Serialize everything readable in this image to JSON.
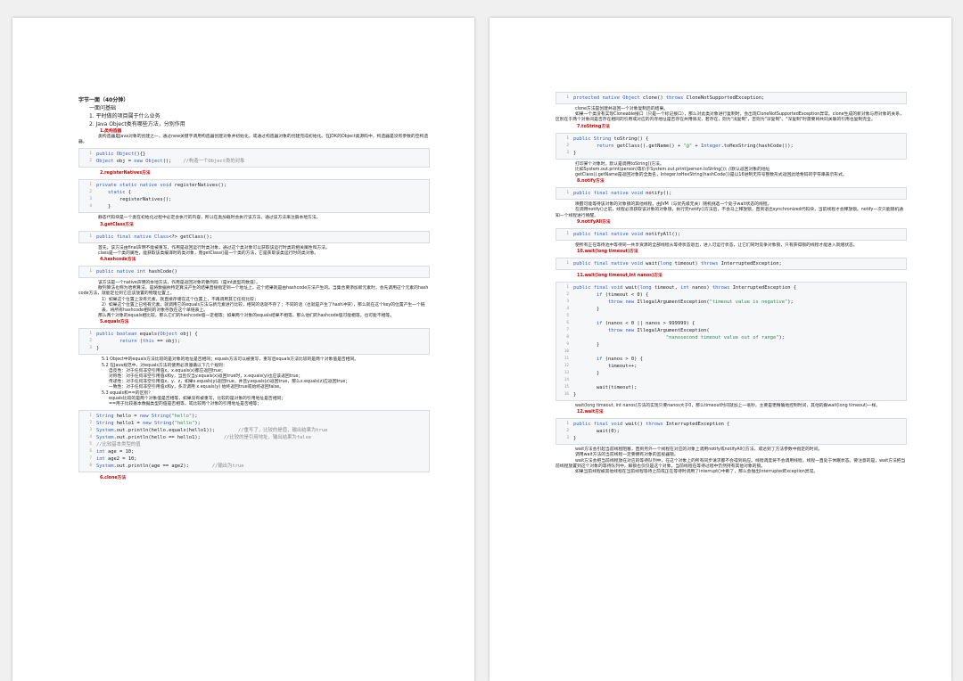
{
  "page1": {
    "heading": "字节一面（40分钟）",
    "sections": [
      {
        "type": "h2",
        "text": "一面问基础"
      },
      {
        "type": "h2",
        "text": "1. 平时做的项目属于什么业务"
      },
      {
        "type": "h2",
        "text": "2. Java Object类有哪些方法，分别作用"
      },
      {
        "type": "h3",
        "text": "1.类构造器"
      },
      {
        "type": "p",
        "text": "类构造器是Java对象的创建之一，通过new关键字调用构造器创建对象并初始化，或通过构造器对象的创建完成初始化。在JDK的Object类源码中，构造器是没有参数的空构造器。"
      },
      {
        "type": "code",
        "lines": [
          "public Object(){}",
          "Object obj = new Object();    //构造一个Object类的对象"
        ]
      },
      {
        "type": "h3",
        "text": "2.registerNatives方法"
      },
      {
        "type": "code",
        "lines": [
          "private static native void registerNatives();",
          "    static {",
          "        registerNatives();",
          "    }"
        ]
      },
      {
        "type": "p",
        "text": "静态代码块是一个类在初始化过程中必定会执行的内容，所以在类加载时会执行该方法，通过该方法来注册本地方法。"
      },
      {
        "type": "h3",
        "text": "3.getClass方法"
      },
      {
        "type": "code",
        "lines": [
          "public final native Class<?> getClass();"
        ]
      },
      {
        "type": "p",
        "text": "首先，该方法由final声明不能被重写，作用是返回运行时类对象，通过这个类对象可以获取该运行时类的相关属性和方法。"
      },
      {
        "type": "p",
        "text": "class是一个类的属性，能获取该类编译时的类对象，而getClass()是一个类的方法，它是获取该类运行时的类对象。"
      },
      {
        "type": "h3",
        "text": "4.hashcode方法"
      },
      {
        "type": "code",
        "lines": [
          "public native int hashCode()"
        ]
      },
      {
        "type": "p",
        "text": "该方法是一个native声明的本地方法，作用是返回对象的散列码（是int类型的数值）。"
      },
      {
        "type": "p",
        "text": "散列算法也称为哈希算法，是将数据依特定算法产生的结果直接指定到一个地址上，这个结果就是由hashcode方法产生的。当集合要添加新元素时，会先调用这个元素的hashcode方法，就能定位到它应该放置的物理位置上。"
      },
      {
        "type": "p2",
        "text": "1）如果这个位置上没有元素，就直接存储在这个位置上，不再调用其它任何比较；"
      },
      {
        "type": "p2",
        "text": "2）如果这个位置上已经有元素，就调用它的equals方法与新元素进行比较，相同的话就不存了；不同的话（也就是产生了hash冲突），那么就在这个key的位置产生一个链表，将所有hashcode相同的对象存放在这个单链表上。"
      },
      {
        "type": "p",
        "text": "那么两个对象的equals相比较，那么它们的hashcode值一定相等；如果两个对象的equals结果不相等，那么他们的hashcode值可能相等，也可能不相等。"
      },
      {
        "type": "h3",
        "text": "5.equals方法"
      },
      {
        "type": "code",
        "lines": [
          "public boolean equals(Object obj) {",
          "        return (this == obj);",
          "}"
        ]
      },
      {
        "type": "p2",
        "text": "5.1 Object中的equals方法比较的是对象的地址是否相同；equals方法可以被重写，重写后equals方法比较的是两个对象值是否相同。"
      },
      {
        "type": "p2",
        "text": "5.2 在Java规范中，对equals方法的使用必须遵循以下几个规则："
      },
      {
        "type": "p3",
        "text": "自反性：对于任何非空引用值x，x.equals(x)都应返回true；"
      },
      {
        "type": "p3",
        "text": "对称性：对于任何非空引用值x和y，当且仅当y.equals(x)返回true时，x.equals(y)也应该返回true；"
      },
      {
        "type": "p3",
        "text": "传递性：对于任何非空引用值x、y、z，如果x.equals(y)返回true，并且y.equals(z)返回true，那么x.equals(z)应返回true；"
      },
      {
        "type": "p3",
        "text": "一致性：对于任何非空引用值x和y，多次调用 x.equals(y) 始终返回true或始终返回false。"
      },
      {
        "type": "p2",
        "text": "5.3 equals和==的区别？"
      },
      {
        "type": "p3",
        "text": "equals比较的是两个对象值是否相等，如果没有被重写，比较的是对象的引用地址是否相同；"
      },
      {
        "type": "p3",
        "text": "==用于比较基本数据类型的值是否相等，或比较两个对象的引用地址是否相等；"
      },
      {
        "type": "code",
        "lines": [
          "String hello = new String(\"hello\");",
          "String hello1 = new String(\"hello\");",
          "System.out.println(hello.equals(hello1));        //重写了，比较的是值，输出结果为true",
          "System.out.println(hello == hello1);        //比较的是引用地址，输出结果为false",
          "//比较基本类型的值",
          "int age = 10;",
          "int age2 = 10;",
          "System.out.println(age == age2);        //输出为true"
        ]
      },
      {
        "type": "h3",
        "text": "6.clone方法"
      }
    ]
  },
  "page2": {
    "sections": [
      {
        "type": "code",
        "lines": [
          "protected native Object clone() throws CloneNotSupportedException;"
        ]
      },
      {
        "type": "p",
        "text": "clone方法是创建并返回一个对象复制后的结果。"
      },
      {
        "type": "p",
        "text": "如果一个类没有实现Cloneable接口（只是一个标记接口），那么对此类对象进行复制时，会出现CloneNotSupportedException异常。clone生成的新对象与原对象的关系，区别在于两个对象间是否存在相同的引用或对应的内存地址是否存在共用情况，若存在，则为\"浅复制\"，否则为\"深复制\"。\"深复制\"时需要将共同关联的引用也复制完全。"
      },
      {
        "type": "h3",
        "text": "7.toString方法"
      },
      {
        "type": "code",
        "lines": [
          "public String toString() {",
          "        return getClass().getName() + \"@\" + Integer.toHexString(hashCode());",
          "}"
        ]
      },
      {
        "type": "p",
        "text": "打印某个对象时，默认是调用toString()方法。"
      },
      {
        "type": "p",
        "text": "比如System.out.print(person)等价于System.out.print(person.toString());  //默认返回对象的地址"
      },
      {
        "type": "p",
        "text": "getClass().getName是返回对象的全类名，Integer.toHexString(hashCode())是以16进制无符号整数形式返回此哈希码的字符串表示形式。"
      },
      {
        "type": "h3",
        "text": "8.notify方法"
      },
      {
        "type": "code",
        "lines": [
          "public final native void notify();"
        ]
      },
      {
        "type": "p",
        "text": "唤醒可能等待该对象的对象锁的其他线程。由JVM（与优先级无关）随机挑选一个处于wait状态的线程。"
      },
      {
        "type": "p",
        "text": "在调用notify()之前，线程必须获取该对象的对象锁，执行完notify()方法后，不会马上释放锁，直到退出synchronized代码块，当前线程才会释放锁。notify一次只能随机通知一个线程进行唤醒。"
      },
      {
        "type": "h3",
        "text": "9.notifyAll方法"
      },
      {
        "type": "code",
        "lines": [
          "public final native void notifyAll();"
        ]
      },
      {
        "type": "p",
        "text": "使所有正在等待池中等待同一共享资源的全部线程从等待状态退出，进入可运行状态，让它们同时竞争对象锁，只有获得锁的线程才能进入就绪状态。"
      },
      {
        "type": "h3",
        "text": "10.wait(long timeout)方法"
      },
      {
        "type": "code",
        "lines": [
          "public final native void wait(long timeout) throws InterruptedException;"
        ]
      },
      {
        "type": "h3",
        "text": "11.wait(long timeout,int nanos)方法"
      },
      {
        "type": "code",
        "lines": [
          "public final void wait(long timeout, int nanos) throws InterruptedException {",
          "        if (timeout < 0) {",
          "            throw new IllegalArgumentException(\"timeout value is negative\");",
          "        }",
          "",
          "        if (nanos < 0 || nanos > 999999) {",
          "            throw new IllegalArgumentException(",
          "                                \"nanosecond timeout value out of range\");",
          "        }",
          "",
          "        if (nanos > 0) {",
          "            timeout++;",
          "        }",
          "",
          "        wait(timeout);",
          "}"
        ]
      },
      {
        "type": "p",
        "text": "wait(long timeout, int nanos)方法的实现只要nanos大于0，那么timeout时间就加上一毫秒，主要是更精确地控制时间，其他的跟wait(long timeout)一样。"
      },
      {
        "type": "h3",
        "text": "12.wait方法"
      },
      {
        "type": "code",
        "lines": [
          "public final void wait() throws InterruptedException {",
          "        wait(0);",
          "}"
        ]
      },
      {
        "type": "p",
        "text": "wait方法会引起当前线程阻塞，直到另外一个线程在对应的对象上调用notify或notifyAll()方法，或达到了方法参数中指定的时间。"
      },
      {
        "type": "p",
        "text": "调用wait方法的当前线程一定要拥有对象的监视器锁。"
      },
      {
        "type": "p",
        "text": "wait方法会把当前线程放在对应的等待队列中，在这个对象上的所有同步请求都不会得到响应。线程调度将不会调用线程，线程一直处于休眠状态。要注意的是，wait方法把当前线程放置到这个对象的等待队列中，解锁也仅仅是这个对象，当前线程在等待过程中仍然持有其他对象的锁。"
      },
      {
        "type": "p",
        "text": "如果当前线程被其他线程在当前线程等待之前或正在等待时调用了interrupt()中断了，那么会抛出InterruptedException异常。"
      }
    ]
  }
}
